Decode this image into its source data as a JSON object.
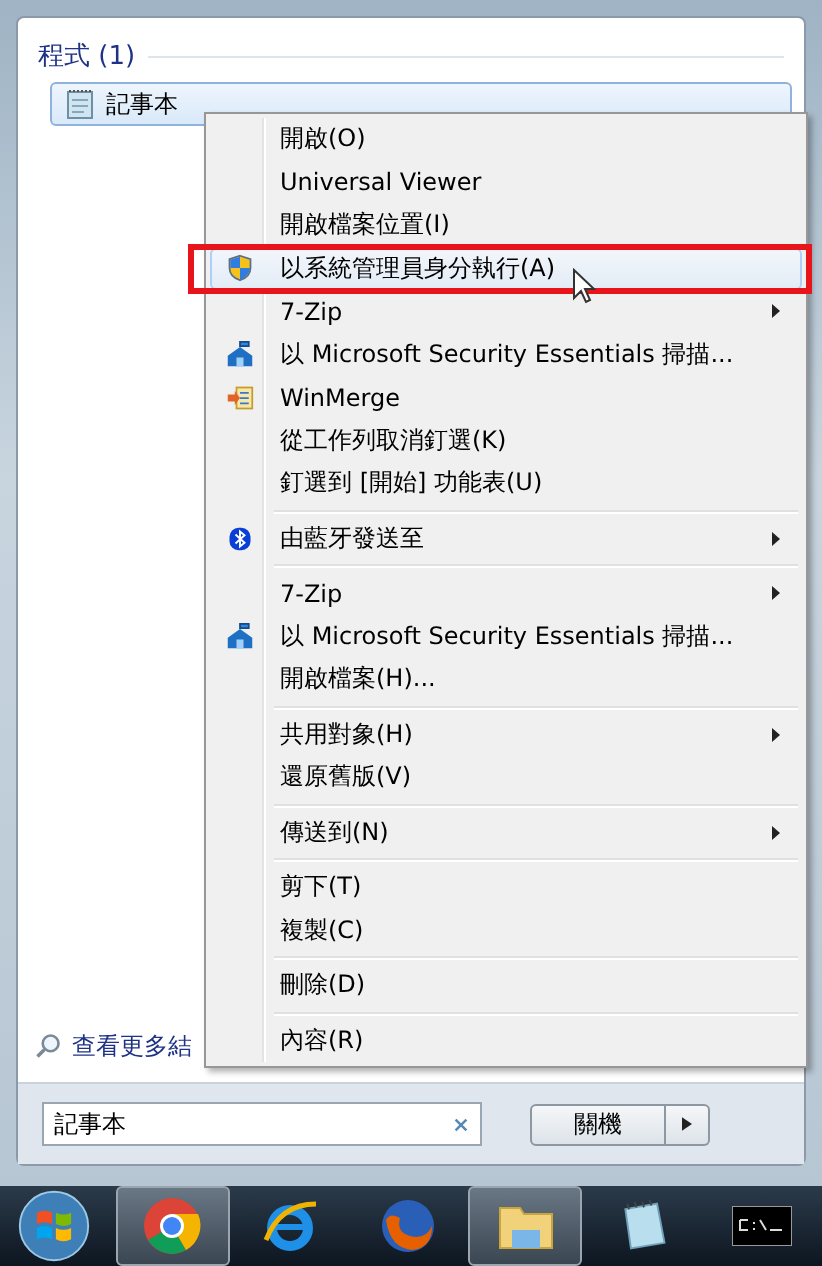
{
  "results": {
    "heading": "程式 (1)",
    "items": [
      {
        "label": "記事本",
        "selected": true
      }
    ]
  },
  "more_results": "查看更多結",
  "context_menu": [
    {
      "kind": "item",
      "label": "開啟(O)",
      "selected": false
    },
    {
      "kind": "item",
      "label": "Universal Viewer",
      "selected": false
    },
    {
      "kind": "item",
      "label": "開啟檔案位置(I)",
      "selected": false
    },
    {
      "kind": "shield",
      "label": "以系統管理員身分執行(A)",
      "selected": true
    },
    {
      "kind": "item",
      "label": "7-Zip",
      "submenu": true,
      "selected": false
    },
    {
      "kind": "scanner",
      "label": "以 Microsoft Security Essentials 掃描...",
      "selected": false
    },
    {
      "kind": "merge",
      "label": "WinMerge",
      "selected": false
    },
    {
      "kind": "item",
      "label": "從工作列取消釘選(K)",
      "selected": false
    },
    {
      "kind": "item",
      "label": "釘選到 [開始] 功能表(U)",
      "selected": false
    },
    {
      "kind": "separator"
    },
    {
      "kind": "bluetooth",
      "label": "由藍牙發送至",
      "submenu": true,
      "selected": false
    },
    {
      "kind": "separator"
    },
    {
      "kind": "item",
      "label": "7-Zip",
      "submenu": true,
      "selected": false
    },
    {
      "kind": "scanner",
      "label": "以 Microsoft Security Essentials 掃描...",
      "selected": false
    },
    {
      "kind": "item",
      "label": "開啟檔案(H)...",
      "selected": false
    },
    {
      "kind": "separator"
    },
    {
      "kind": "item",
      "label": "共用對象(H)",
      "submenu": true,
      "selected": false
    },
    {
      "kind": "item",
      "label": "還原舊版(V)",
      "selected": false
    },
    {
      "kind": "separator"
    },
    {
      "kind": "item",
      "label": "傳送到(N)",
      "submenu": true,
      "selected": false
    },
    {
      "kind": "separator"
    },
    {
      "kind": "item",
      "label": "剪下(T)",
      "selected": false
    },
    {
      "kind": "item",
      "label": "複製(C)",
      "selected": false
    },
    {
      "kind": "separator"
    },
    {
      "kind": "item",
      "label": "刪除(D)",
      "selected": false
    },
    {
      "kind": "separator"
    },
    {
      "kind": "item",
      "label": "內容(R)",
      "selected": false
    }
  ],
  "search": {
    "value": "記事本"
  },
  "shutdown": {
    "label": "關機"
  },
  "taskbar": [
    {
      "kind": "start"
    },
    {
      "kind": "chrome",
      "active": true
    },
    {
      "kind": "ie",
      "active": false
    },
    {
      "kind": "firefox",
      "active": false
    },
    {
      "kind": "explorer",
      "active": true
    },
    {
      "kind": "notepad",
      "active": false
    },
    {
      "kind": "cmd",
      "active": false
    }
  ]
}
